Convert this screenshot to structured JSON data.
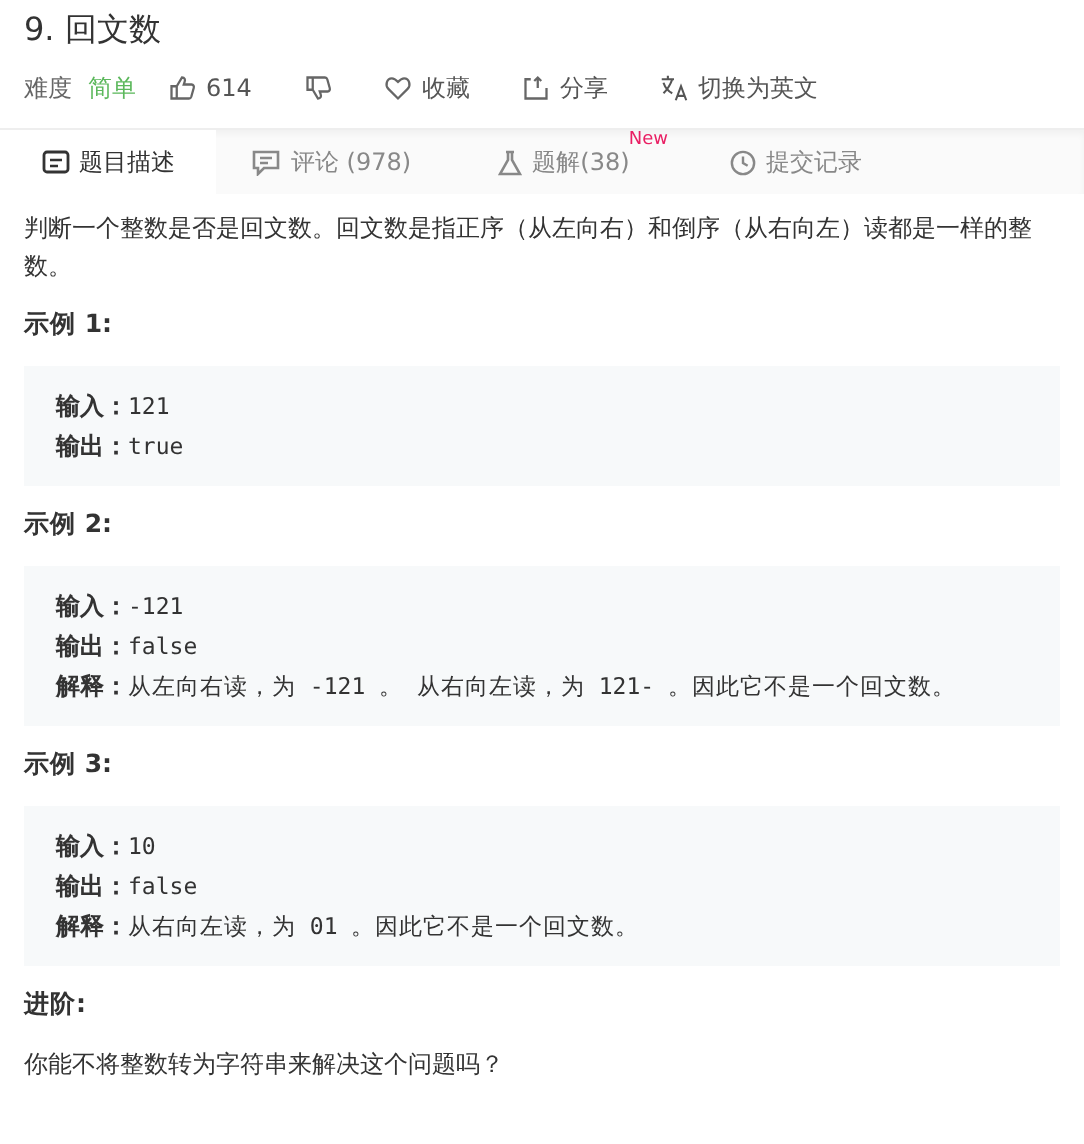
{
  "title": "9. 回文数",
  "meta": {
    "difficulty_label": "难度",
    "difficulty": "简单",
    "likes": "614",
    "favorite": "收藏",
    "share": "分享",
    "switch_language": "切换为英文"
  },
  "tabs": [
    {
      "label": "题目描述",
      "selected": true
    },
    {
      "label": "评论 (978)",
      "selected": false
    },
    {
      "label": "题解(38)",
      "selected": false,
      "badge": "New"
    },
    {
      "label": "提交记录",
      "selected": false
    }
  ],
  "description": "判断一个整数是否是回文数。回文数是指正序（从左向右）和倒序（从右向左）读都是一样的整数。",
  "examples": [
    {
      "heading": "示例 1:",
      "lines": [
        {
          "label": "输入：",
          "value": "121"
        },
        {
          "label": "输出：",
          "value": "true"
        }
      ]
    },
    {
      "heading": "示例 2:",
      "lines": [
        {
          "label": "输入：",
          "value": "-121"
        },
        {
          "label": "输出：",
          "value": "false"
        },
        {
          "label": "解释：",
          "value": "从左向右读，为 -121 。 从右向左读，为 121- 。因此它不是一个回文数。"
        }
      ]
    },
    {
      "heading": "示例 3:",
      "lines": [
        {
          "label": "输入：",
          "value": "10"
        },
        {
          "label": "输出：",
          "value": "false"
        },
        {
          "label": "解释：",
          "value": "从右向左读，为 01 。因此它不是一个回文数。"
        }
      ]
    }
  ],
  "advanced": {
    "heading": "进阶:",
    "text": "你能不将整数转为字符串来解决这个问题吗？"
  }
}
